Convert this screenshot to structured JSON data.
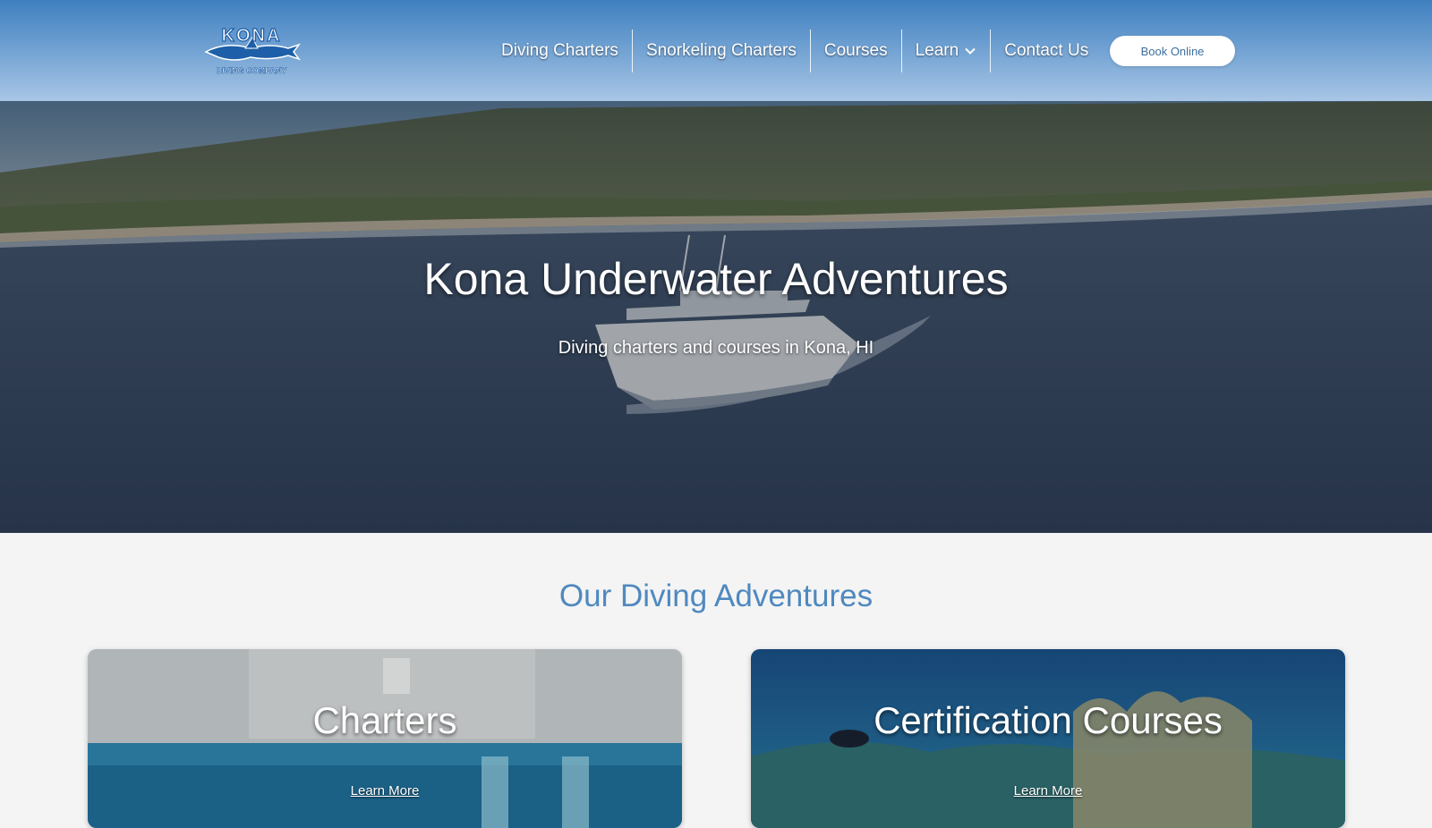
{
  "brand": {
    "logo_text": "KONA",
    "logo_subtext": "DIVING COMPANY"
  },
  "nav": {
    "items": [
      {
        "label": "Diving Charters"
      },
      {
        "label": "Snorkeling Charters"
      },
      {
        "label": "Courses"
      },
      {
        "label": "Learn",
        "icon": "chevron-down-icon"
      },
      {
        "label": "Contact Us"
      }
    ],
    "book_label": "Book Online"
  },
  "hero": {
    "title": "Kona Underwater Adventures",
    "subtitle": "Diving charters and courses in Kona, HI"
  },
  "section": {
    "title": "Our Diving Adventures",
    "cards": [
      {
        "title": "Charters",
        "link": "Learn More"
      },
      {
        "title": "Certification Courses",
        "link": "Learn More"
      }
    ]
  },
  "colors": {
    "header_top": "#3f7fbf",
    "header_bottom": "#a9c6e6",
    "section_title": "#4f89bf",
    "button_text": "#3d6f9f",
    "page_bg": "#f4f4f4"
  }
}
